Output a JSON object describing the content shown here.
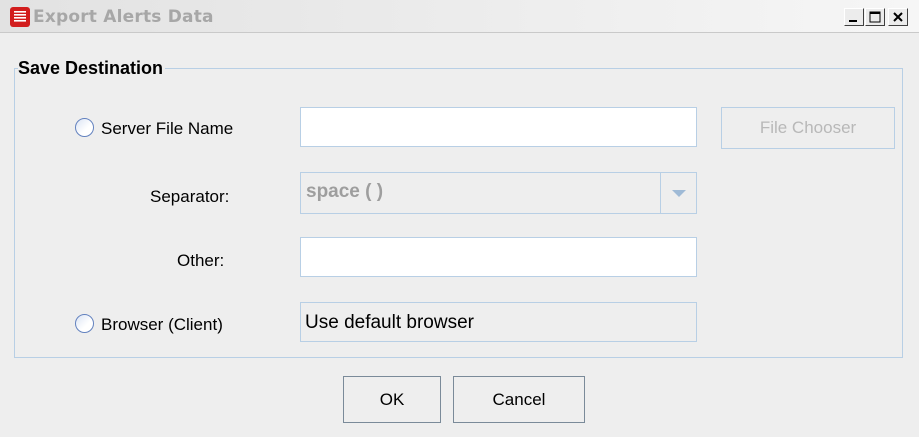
{
  "window": {
    "title": "Export Alerts Data"
  },
  "group": {
    "label": "Save Destination"
  },
  "server": {
    "label": "Server File Name",
    "value": "",
    "chooser_label": "File Chooser"
  },
  "separator": {
    "label": "Separator:",
    "selected": "space (  )"
  },
  "other": {
    "label": "Other:",
    "value": ""
  },
  "browser": {
    "label": "Browser (Client)",
    "value": "Use default browser"
  },
  "footer": {
    "ok_label": "OK",
    "cancel_label": "Cancel"
  },
  "colors": {
    "border": "#b8cfe5",
    "background": "#eeeeee",
    "icon": "#d21e1e"
  }
}
